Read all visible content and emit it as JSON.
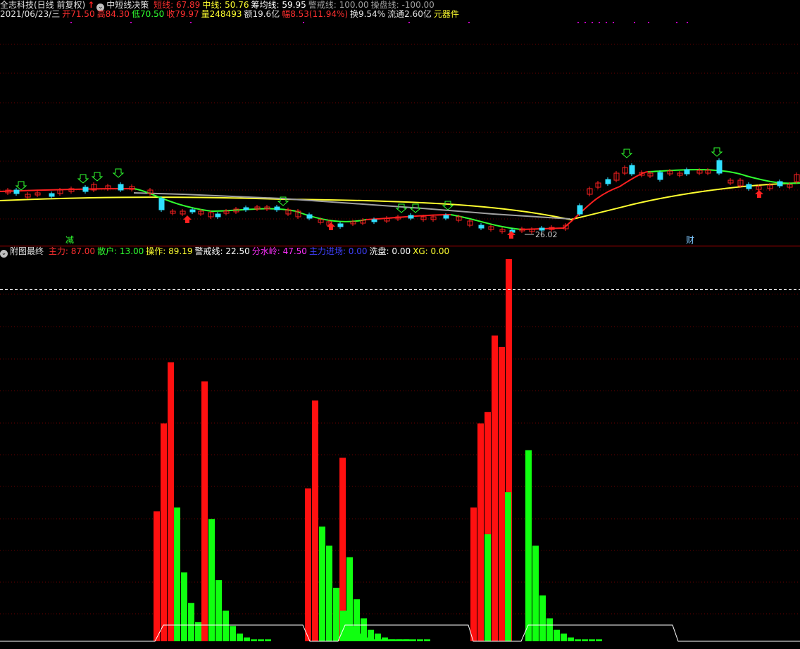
{
  "header": {
    "stock_title": "全志科技(日线 前复权)",
    "indicator_name": "中短线决策",
    "indicators": [
      {
        "label": "短线: 67.89",
        "color": "#ff3030"
      },
      {
        "label": "中线: 50.76",
        "color": "#ffff30"
      },
      {
        "label": "筹均线: 59.95",
        "color": "#ffffff"
      },
      {
        "label": "警戒线: 100.00",
        "color": "#a0a0a0"
      },
      {
        "label": "操盘线: -100.00",
        "color": "#a0a0a0"
      }
    ]
  },
  "quote": {
    "date": "2021/06/23/三",
    "items": [
      {
        "label": "开71.50",
        "color": "#ff3030"
      },
      {
        "label": "高84.30",
        "color": "#ff3030"
      },
      {
        "label": "低70.50",
        "color": "#30ff30"
      },
      {
        "label": "收79.97",
        "color": "#ff3030"
      },
      {
        "label": "量248493",
        "color": "#ffff30"
      },
      {
        "label": "额19.6亿",
        "color": "#e0e0e0"
      },
      {
        "label": "幅8.53(11.94%)",
        "color": "#ff3030"
      },
      {
        "label": "换9.54%",
        "color": "#e0e0e0"
      },
      {
        "label": "流通2.60亿",
        "color": "#e0e0e0"
      },
      {
        "label": "元器件",
        "color": "#ffff30"
      }
    ]
  },
  "price_panel": {
    "signal_labels": [
      {
        "text": "减",
        "color": "#30ff30"
      },
      {
        "text": "财",
        "color": "#80c8ff"
      }
    ],
    "low_annotation": "26.02"
  },
  "sub_panel": {
    "title": "附图最终",
    "indicators": [
      {
        "label": "主力: 87.00",
        "color": "#ff3030"
      },
      {
        "label": "散户: 13.00",
        "color": "#30ff30"
      },
      {
        "label": "操作: 89.19",
        "color": "#ffff30"
      },
      {
        "label": "警戒线: 22.50",
        "color": "#ffffff"
      },
      {
        "label": "分水岭: 47.50",
        "color": "#ff30ff"
      },
      {
        "label": "主力进场: 0.00",
        "color": "#4040ff"
      },
      {
        "label": "洗盘: 0.00",
        "color": "#ffffff"
      },
      {
        "label": "XG: 0.00",
        "color": "#ffff30"
      }
    ]
  },
  "chart_data": {
    "type": "bar",
    "main_force_groups": [
      {
        "start": 220,
        "values": [
          34,
          57,
          73
        ]
      },
      {
        "start": 288,
        "values": [
          68
        ]
      },
      {
        "start": 435,
        "values": [
          40,
          63
        ]
      },
      {
        "start": 484,
        "values": [
          48
        ]
      },
      {
        "start": 670,
        "values": [
          35,
          57,
          60,
          80,
          77,
          100
        ]
      }
    ],
    "retail_series": [
      {
        "start": 249,
        "values": [
          35,
          18,
          10,
          5
        ]
      },
      {
        "start": 298,
        "values": [
          32,
          16,
          8,
          4,
          2,
          1,
          0.5,
          0.5,
          0.5
        ]
      },
      {
        "start": 455,
        "values": [
          30,
          25,
          14,
          8,
          4,
          2,
          1,
          0.5,
          0.5,
          0.5,
          0.5,
          0.5,
          0.5
        ]
      },
      {
        "start": 494,
        "values": [
          22,
          11,
          6,
          3,
          2,
          1,
          0.5,
          0.5,
          0.5,
          0.5,
          0.5,
          0.5
        ]
      },
      {
        "start": 690,
        "values": [
          28
        ]
      },
      {
        "start": 719,
        "values": [
          39
        ]
      },
      {
        "start": 748,
        "values": [
          50,
          25,
          12,
          6,
          3,
          2,
          1,
          0.5,
          0.5,
          0.5,
          0.5
        ]
      }
    ],
    "warning_line": 92
  }
}
